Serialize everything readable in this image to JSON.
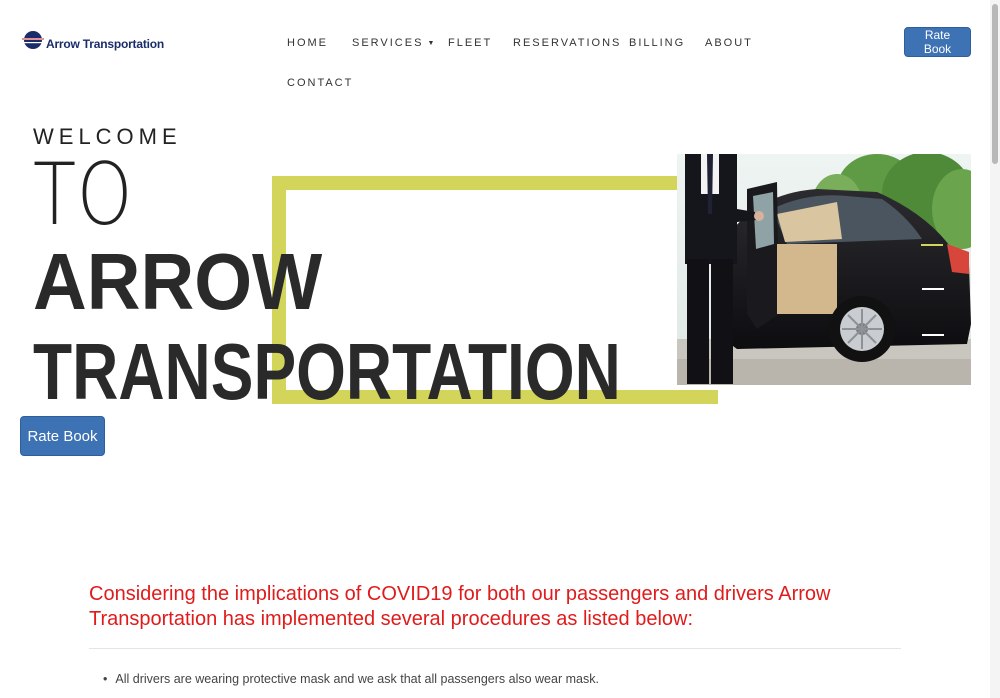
{
  "brand": {
    "name": "Arrow Transportation"
  },
  "nav": {
    "items": [
      {
        "label": "HOME"
      },
      {
        "label": "SERVICES"
      },
      {
        "label": "FLEET"
      },
      {
        "label": "RESERVATIONS"
      },
      {
        "label": "BILLING"
      },
      {
        "label": "ABOUT"
      },
      {
        "label": "CONTACT"
      }
    ]
  },
  "header": {
    "rate_book_label": "Rate Book"
  },
  "hero": {
    "welcome": "WELCOME",
    "to": "TO",
    "line1": "ARROW",
    "line2": "TRANSPORTATION",
    "rate_book_label": "Rate Book"
  },
  "covid": {
    "heading": "Considering the implications of COVID19 for both our passengers and drivers Arrow Transportation has implemented several procedures as listed below:",
    "items": [
      "All drivers are wearing protective mask and we ask that all passengers also wear mask."
    ]
  },
  "colors": {
    "accent_yellow": "#d2d559",
    "button_blue": "#3d72b4",
    "covid_red": "#e01b1b",
    "logo_navy": "#1a2d6b"
  }
}
